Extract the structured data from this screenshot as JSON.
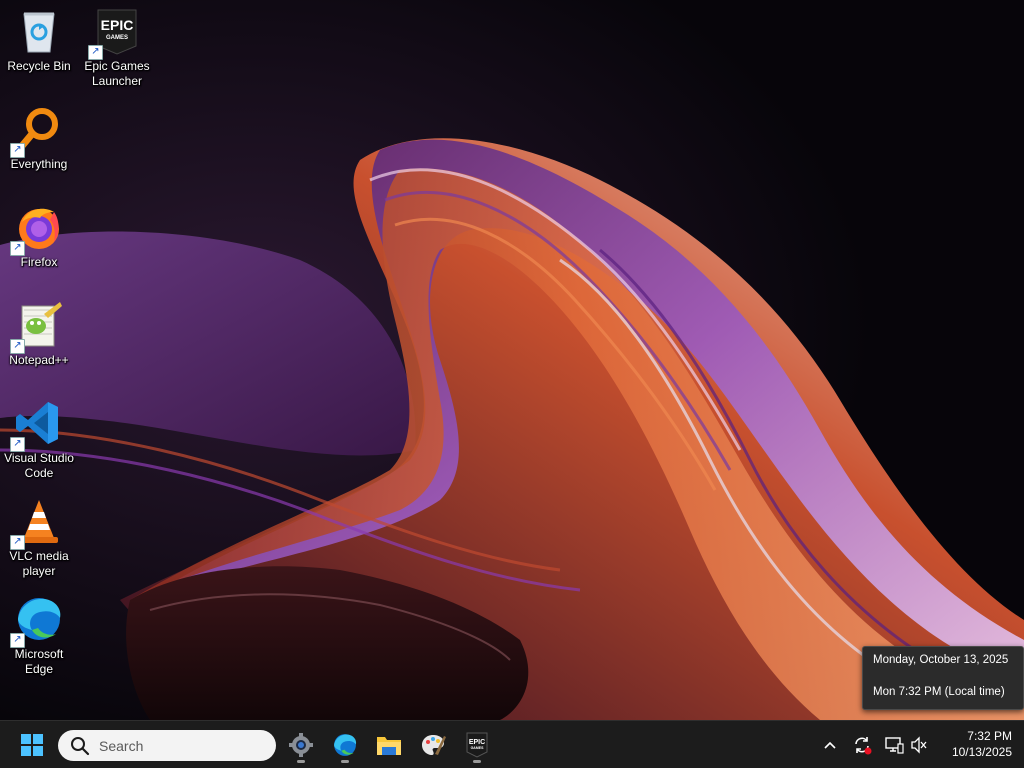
{
  "desktop": {
    "icons": [
      {
        "label": "Recycle Bin",
        "icon": "recycle-bin-icon"
      },
      {
        "label": "Epic Games\nLauncher",
        "icon": "epic-games-icon"
      },
      {
        "label": "Everything",
        "icon": "everything-search-icon"
      },
      {
        "label": "Firefox",
        "icon": "firefox-icon"
      },
      {
        "label": "Notepad++",
        "icon": "notepad-plus-plus-icon"
      },
      {
        "label": "Visual Studio\nCode",
        "icon": "vscode-icon"
      },
      {
        "label": "VLC media\nplayer",
        "icon": "vlc-icon"
      },
      {
        "label": "Microsoft\nEdge",
        "icon": "edge-icon"
      }
    ],
    "epic_logo_text": "EPIC",
    "epic_logo_sub": "GAMES"
  },
  "tooltip": {
    "date_line": "Monday, October 13, 2025",
    "time_line": "Mon 7:32 PM (Local time)"
  },
  "taskbar": {
    "search_placeholder": "Search",
    "pinned": [
      {
        "name": "settings",
        "icon": "gear-icon"
      },
      {
        "name": "edge",
        "icon": "edge-icon"
      },
      {
        "name": "file-explorer",
        "icon": "folder-icon"
      },
      {
        "name": "paint",
        "icon": "paint-palette-icon"
      },
      {
        "name": "epic-games",
        "icon": "epic-games-icon"
      }
    ],
    "tray_icons": [
      "chevron-up-icon",
      "sync-icon",
      "network-icon",
      "volume-muted-icon"
    ],
    "clock_time": "7:32 PM",
    "clock_date": "10/13/2025"
  },
  "colors": {
    "taskbar_bg": "#1c1c1c",
    "accent_blue": "#1a7fd4",
    "wallpaper_purple": "#5b2a6e",
    "wallpaper_orange": "#d8653a"
  }
}
